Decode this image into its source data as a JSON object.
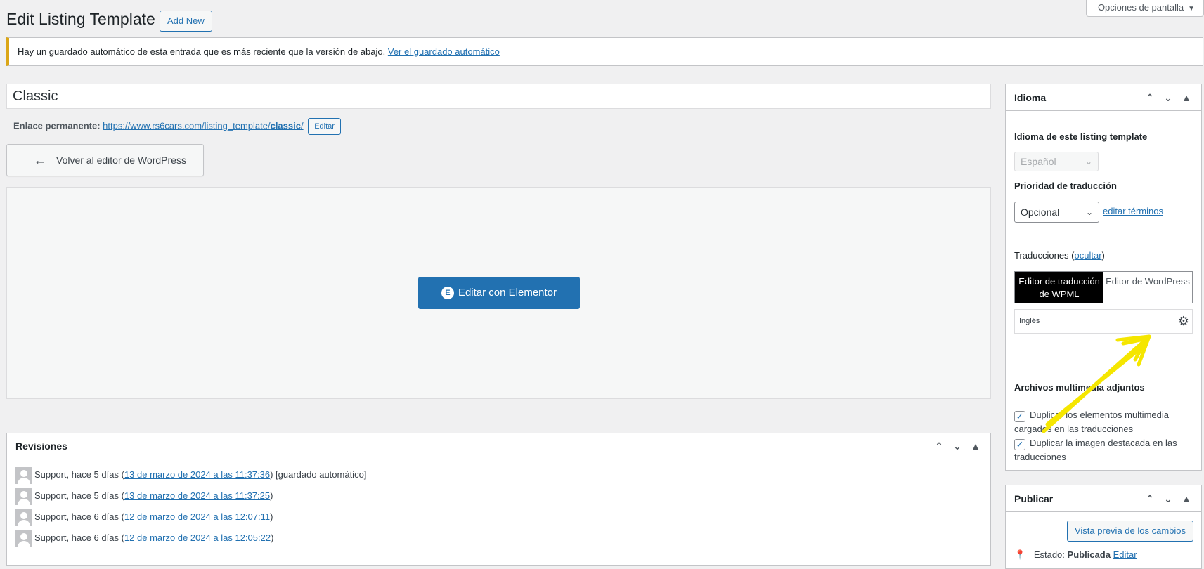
{
  "header": {
    "title": "Edit Listing Template",
    "add_new": "Add New",
    "screen_options": "Opciones de pantalla"
  },
  "notice": {
    "text": "Hay un guardado automático de esta entrada que es más reciente que la versión de abajo.",
    "link": "Ver el guardado automático"
  },
  "post": {
    "title": "Classic",
    "permalink_label": "Enlace permanente:",
    "permalink_url_base": "https://www.rs6cars.com/listing_template/",
    "permalink_slug": "classic",
    "permalink_url_end": "/",
    "permalink_edit": "Editar",
    "back_button": "Volver al editor de WordPress",
    "elementor_button": "Editar con Elementor"
  },
  "revisions": {
    "title": "Revisiones",
    "items": [
      {
        "prefix": "Support, hace 5 días (",
        "link": "13 de marzo de 2024 a las 11:37:36",
        "suffix": ") [guardado automático]"
      },
      {
        "prefix": "Support, hace 5 días (",
        "link": "13 de marzo de 2024 a las 11:37:25",
        "suffix": ")"
      },
      {
        "prefix": "Support, hace 6 días (",
        "link": "12 de marzo de 2024 a las 12:07:11",
        "suffix": ")"
      },
      {
        "prefix": "Support, hace 6 días (",
        "link": "12 de marzo de 2024 a las 12:05:22",
        "suffix": ")"
      }
    ]
  },
  "sidebar": {
    "idioma": {
      "title": "Idioma",
      "lang_label": "Idioma de este listing template",
      "lang_value": "Español",
      "priority_label": "Prioridad de traducción",
      "priority_value": "Opcional",
      "edit_terms": "editar términos",
      "translations_label": "Traducciones (",
      "translations_hide": "ocultar",
      "translations_close": ")",
      "tab_wpml": "Editor de traducción de WPML",
      "tab_wp": "Editor de WordPress",
      "language_row": "Inglés",
      "media_label": "Archivos multimedia adjuntos",
      "cb1": "Duplicar los elementos multimedia cargados en las traducciones",
      "cb2": "Duplicar la imagen destacada en las traducciones"
    },
    "publicar": {
      "title": "Publicar",
      "preview": "Vista previa de los cambios",
      "estado_label": "Estado:",
      "estado_value": "Publicada",
      "estado_edit": "Editar"
    }
  },
  "colors": {
    "accent": "#2271b1",
    "notice_border": "#dba617",
    "annotation": "#f5e600"
  },
  "icons": [
    "arrow-left-icon",
    "elementor-icon",
    "chevron-up-icon",
    "chevron-down-icon",
    "triangle-up-icon",
    "gear-icon",
    "pin-icon",
    "checkbox-checked-icon",
    "avatar-icon"
  ]
}
